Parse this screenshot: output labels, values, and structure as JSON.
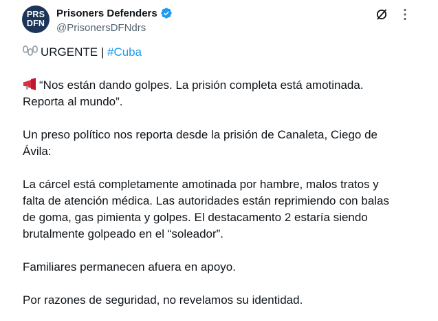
{
  "author": {
    "display_name": "Prisoners Defenders",
    "handle": "@PrisonersDFNdrs",
    "avatar_line1": "PRS",
    "avatar_line2": "DFN",
    "verified": true
  },
  "icons": {
    "verified": "verified-badge-icon",
    "grok": "grok-icon",
    "more": "more-options-icon",
    "chain": "chain-emoji-icon",
    "megaphone": "megaphone-emoji-icon"
  },
  "colors": {
    "link": "#1d9bf0",
    "verified": "#1d9bf0",
    "text": "#0f1419",
    "secondary": "#536471",
    "avatar_bg": "#1c3559"
  },
  "tweet": {
    "line1_prefix": "URGENTE | ",
    "hashtag": "#Cuba",
    "quote_line1": "“Nos están dando golpes. La prisión completa está amotinada.",
    "quote_line2": "Reporta al mundo”.",
    "para2_line1": "Un preso político nos reporta desde la prisión de Canaleta, Ciego de",
    "para2_line2": "Ávila:",
    "para3_line1": "La cárcel está completamente amotinada por hambre, malos tratos y",
    "para3_line2": "falta de atención médica. Las autoridades están reprimiendo con balas",
    "para3_line3": "de goma, gas pimienta y golpes. El destacamento 2 estaría siendo",
    "para3_line4": "brutalmente golpeado en el “soleador”.",
    "para4": "Familiares permanecen afuera en apoyo.",
    "para5": "Por razones de seguridad, no revelamos su identidad."
  }
}
